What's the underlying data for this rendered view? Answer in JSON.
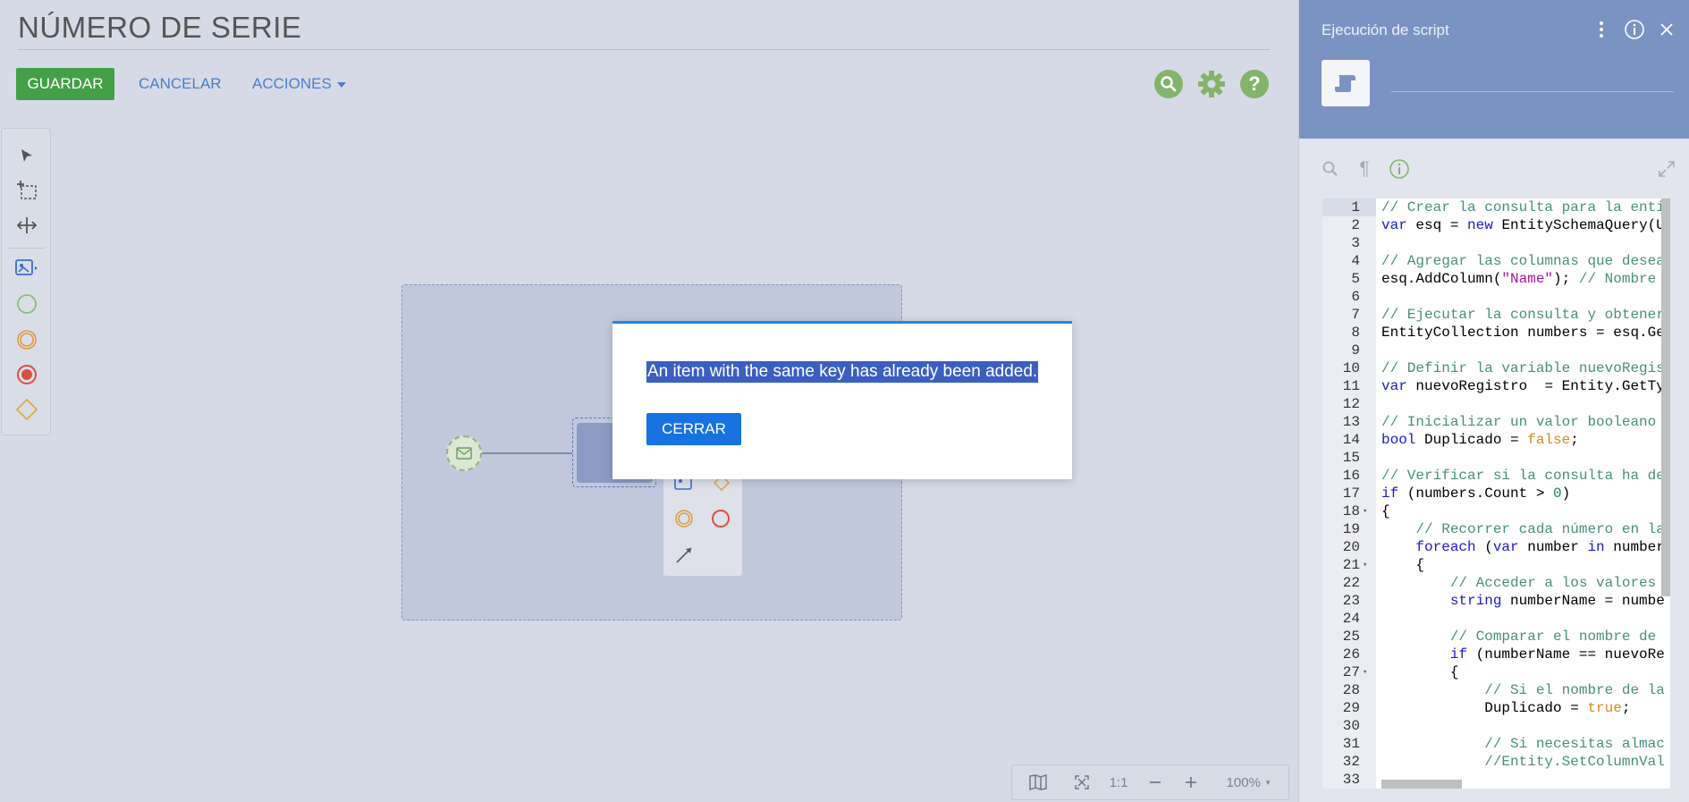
{
  "header": {
    "title": "NÚMERO DE SERIE",
    "save_label": "GUARDAR",
    "cancel_label": "CANCELAR",
    "actions_label": "ACCIONES"
  },
  "top_icons": [
    "search-icon",
    "gear-icon",
    "help-icon"
  ],
  "help_glyph": "?",
  "colors": {
    "save_button": "#43a047",
    "link": "#4a7fc8",
    "panel_header": "#7b93c2",
    "dialog_button": "#1572e0"
  },
  "dialog": {
    "message": "An item with the same key has already been added.",
    "close_label": "CERRAR"
  },
  "zoom_bar": {
    "one_to_one": "1:1",
    "zoom_level": "100%"
  },
  "right_panel": {
    "title": "Ejecución de script",
    "pilcrow": "¶"
  },
  "code_lines": [
    "// Crear la consulta para la enti",
    "var esq = new EntitySchemaQuery(U",
    "",
    "// Agregar las columnas que desea",
    "esq.AddColumn(\"Name\"); // Nombre",
    "",
    "// Ejecutar la consulta y obtener",
    "EntityCollection numbers = esq.Ge",
    "",
    "// Definir la variable nuevoRegis",
    "var nuevoRegistro  = Entity.GetTy",
    "",
    "// Inicializar un valor booleano",
    "bool Duplicado = false;",
    "",
    "// Verificar si la consulta ha de",
    "if (numbers.Count > 0)",
    "{",
    "    // Recorrer cada número en la",
    "    foreach (var number in number",
    "    {",
    "        // Acceder a los valores",
    "        string numberName = numbe",
    "",
    "        // Comparar el nombre de",
    "        if (numberName == nuevoRe",
    "        {",
    "            // Si el nombre de la",
    "            Duplicado = true;",
    "",
    "            // Si necesitas almac",
    "            //Entity.SetColumnVal",
    ""
  ]
}
